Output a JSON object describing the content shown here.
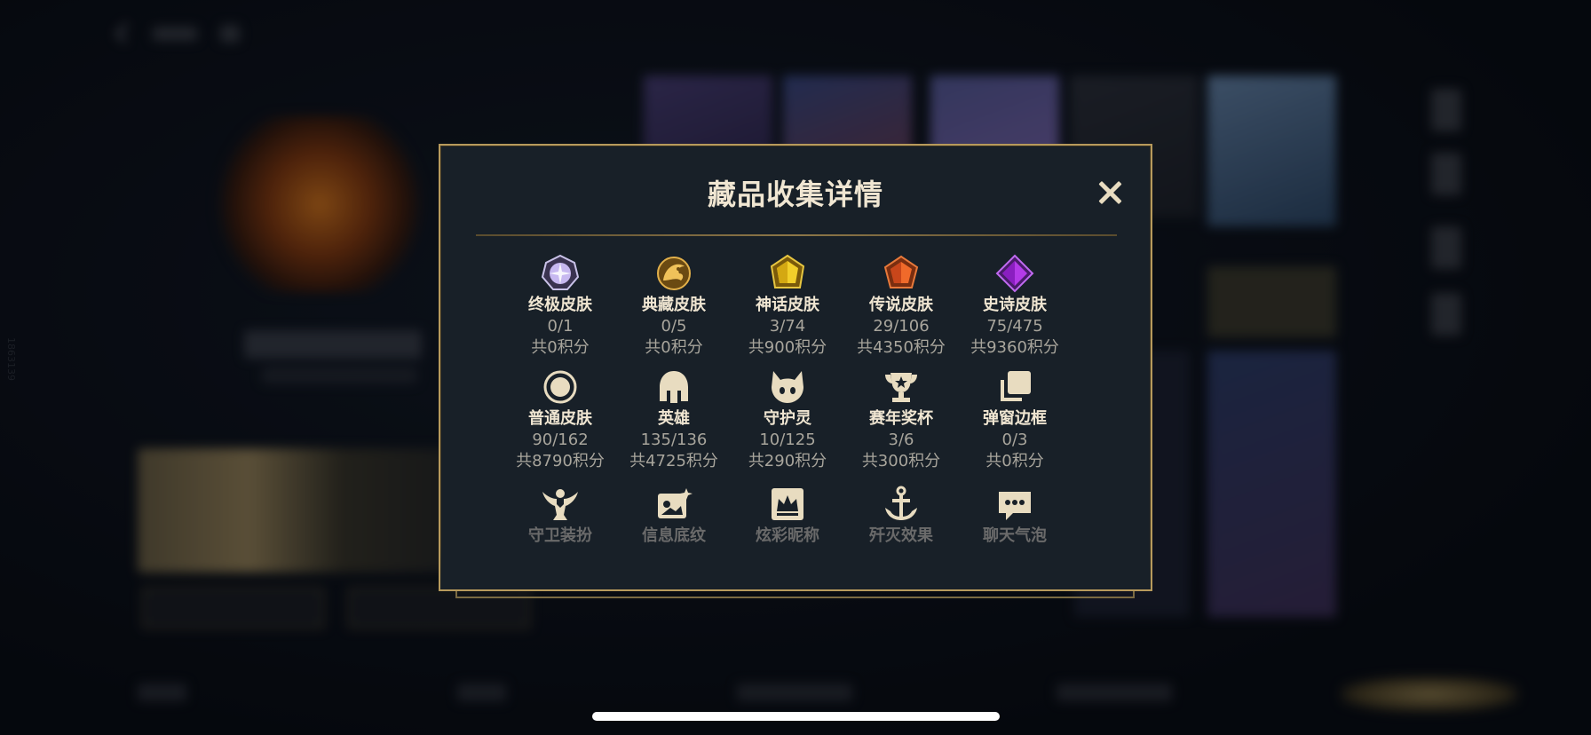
{
  "background": {
    "vertical_number": "1863139"
  },
  "modal": {
    "title": "藏品收集详情",
    "categories": [
      {
        "name": "终极皮肤",
        "count": "0/1",
        "points": "共0积分",
        "icon": "ultimate-skin-icon"
      },
      {
        "name": "典藏皮肤",
        "count": "0/5",
        "points": "共0积分",
        "icon": "prestige-skin-icon"
      },
      {
        "name": "神话皮肤",
        "count": "3/74",
        "points": "共900积分",
        "icon": "mythic-skin-icon"
      },
      {
        "name": "传说皮肤",
        "count": "29/106",
        "points": "共4350积分",
        "icon": "legendary-skin-icon"
      },
      {
        "name": "史诗皮肤",
        "count": "75/475",
        "points": "共9360积分",
        "icon": "epic-skin-icon"
      },
      {
        "name": "普通皮肤",
        "count": "90/162",
        "points": "共8790积分",
        "icon": "standard-skin-icon"
      },
      {
        "name": "英雄",
        "count": "135/136",
        "points": "共4725积分",
        "icon": "champion-helmet-icon"
      },
      {
        "name": "守护灵",
        "count": "10/125",
        "points": "共290积分",
        "icon": "tft-companion-icon"
      },
      {
        "name": "赛年奖杯",
        "count": "3/6",
        "points": "共300积分",
        "icon": "season-trophy-icon"
      },
      {
        "name": "弹窗边框",
        "count": "0/3",
        "points": "共0积分",
        "icon": "popup-frame-icon"
      },
      {
        "name": "守卫装扮",
        "icon": "ward-skin-icon"
      },
      {
        "name": "信息底纹",
        "icon": "banner-background-icon"
      },
      {
        "name": "炫彩昵称",
        "icon": "color-nickname-icon"
      },
      {
        "name": "歼灭效果",
        "icon": "elimination-effect-icon"
      },
      {
        "name": "聊天气泡",
        "icon": "chat-bubble-icon"
      }
    ]
  },
  "colors": {
    "gold_border": "#b79a5c",
    "modal_bg": "#182028",
    "title_text": "#f0e6d2",
    "muted_text": "#a8a59c"
  }
}
